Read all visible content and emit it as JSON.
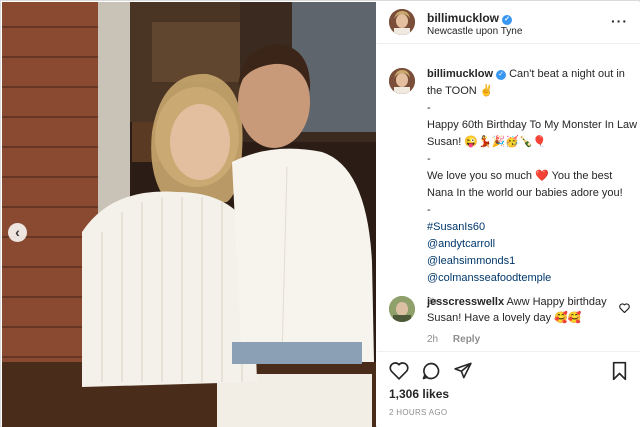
{
  "post": {
    "author": "billimucklow",
    "location": "Newcastle upon Tyne",
    "more_icon": "more-horizontal-icon",
    "verified_mark": "✓"
  },
  "caption": {
    "username": "billimucklow",
    "line1": "Can't beat a night out in the TOON ✌️",
    "dash1": "-",
    "line2": "Happy 60th Birthday To My Monster In Law Susan! 😜💃🎉🥳🍾🎈",
    "dash2": "-",
    "line3a": "We love you so much",
    "line3_heart": "❤️",
    "line3b": "You the best Nana In the world our babies adore you!",
    "dash3": "-",
    "tags": [
      "#SusanIs60",
      "@andytcarroll",
      "@leahsimmonds1",
      "@colmansseafoodtemple"
    ],
    "time": "2h"
  },
  "comment": {
    "username": "jesscresswellx",
    "text": "Aww Happy birthday Susan! Have a lovely day 🥰🥰",
    "time": "2h",
    "reply_label": "Reply"
  },
  "actions": {
    "likes": "1,306 likes",
    "posted_ago": "2 HOURS AGO"
  },
  "colors": {
    "link": "#00376b",
    "verified": "#3897f0",
    "muted": "#8e8e8e"
  },
  "icons": [
    "heart-icon",
    "comment-icon",
    "share-icon",
    "bookmark-icon",
    "chevron-left-icon"
  ]
}
